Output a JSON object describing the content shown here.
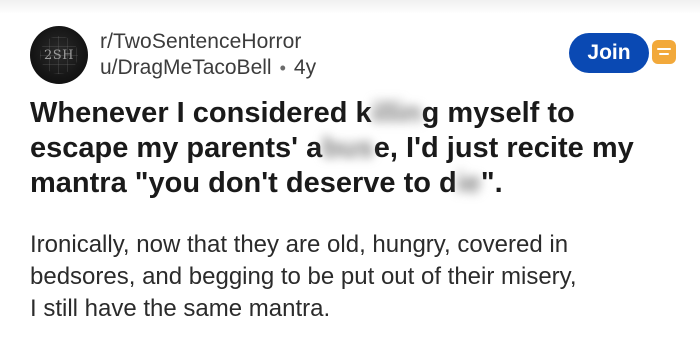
{
  "header": {
    "subreddit": "r/TwoSentenceHorror",
    "username": "u/DragMeTacoBell",
    "separator": "•",
    "age": "4y",
    "avatar_text": "2SH",
    "join_label": "Join"
  },
  "post": {
    "title_lines": [
      {
        "before": "Whenever I considered k",
        "blurred": "illin",
        "after": "g myself to"
      },
      {
        "before": "escape my parents' a",
        "blurred": "bus",
        "after": "e, I'd just recite my"
      },
      {
        "before": "mantra \"you don't deserve to d",
        "blurred": "ie",
        "after": "\"."
      }
    ],
    "body_lines": [
      "Ironically, now that they are old, hungry, covered in",
      "bedsores, and begging to be put out of their misery,",
      "I still have the same mantra."
    ]
  },
  "colors": {
    "join_button": "#0a49b3",
    "inbox_icon": "#f2a93b",
    "avatar": "#151515"
  },
  "icons": {
    "inbox": "inbox-icon"
  }
}
